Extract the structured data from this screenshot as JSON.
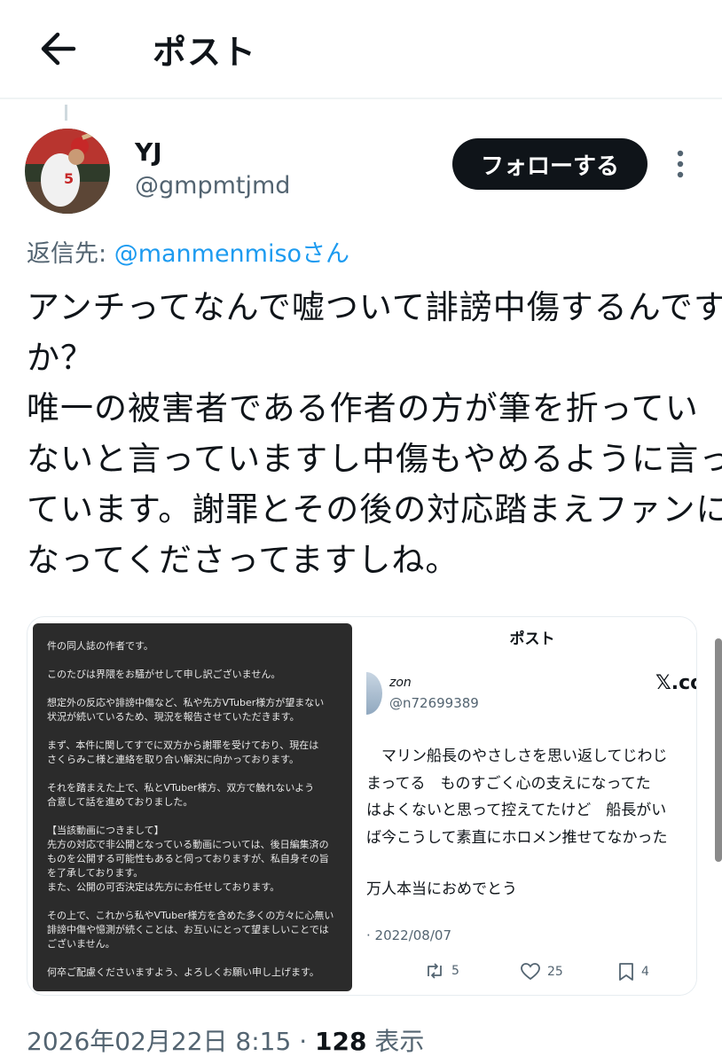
{
  "header": {
    "title": "ポスト"
  },
  "author": {
    "display_name": "YJ",
    "handle": "@gmpmtjmd",
    "avatar_jersey_text": "5"
  },
  "follow_button": {
    "label": "フォローする"
  },
  "reply": {
    "prefix": "返信先: ",
    "mention": "@manmenmisoさん"
  },
  "tweet": {
    "lines": [
      "アンチってなんで嘘ついて誹謗中傷するんです",
      "か？",
      "唯一の被害者である作者の方が筆を折ってい",
      "ないと言っていますし中傷もやめるように言っ",
      "ています。謝罪とその後の対応踏まえファンに",
      "なってくださってますしね。"
    ]
  },
  "media_left": {
    "lines": [
      "件の同人誌の作者です。",
      "",
      "このたびは界隈をお騒がせして申し訳ございません。",
      "",
      "想定外の反応や誹謗中傷など、私や先方VTuber様方が望まない",
      "状況が続いているため、現況を報告させていただきます。",
      "",
      "まず、本件に関してすでに双方から謝罪を受けており、現在は",
      "さくらみこ様と連絡を取り合い解決に向かっております。",
      "",
      "それを踏まえた上で、私とVTuber様方、双方で触れないよう",
      "合意して話を進めておりました。",
      "",
      "【当該動画につきまして】",
      "先方の対応で非公開となっている動画については、後日編集済の",
      "ものを公開する可能性もあると伺っておりますが、私自身その旨",
      "を了承しております。",
      "また、公開の可否決定は先方にお任せしております。",
      "",
      "その上で、これから私やVTuber様方を含めた多くの方々に心無い",
      "誹謗中傷や憶測が続くことは、お互いにとって望ましいことでは",
      "ございません。",
      "",
      "何卒ご配慮くださいますよう、よろしくお願い申し上げます。"
    ]
  },
  "media_right": {
    "title": "ポスト",
    "name": "zon",
    "handle": "@n72699389",
    "x_logo": "𝕏.co",
    "text_lines": [
      "　マリン船長のやさしさを思い返してじわじ",
      "まってる　ものすごく心の支えになってた",
      "はよくないと思って控えてたけど　船長がい",
      "ば今こうして素直にホロメン推せてなかった"
    ],
    "congrats": "万人本当におめでとう",
    "date": "· 2022/08/07",
    "retweets": "5",
    "likes": "25",
    "bookmarks": "4"
  },
  "meta": {
    "timestamp": "2026年02月22日 8:15 · ",
    "views_count": "128",
    "views_label": " 表示"
  }
}
